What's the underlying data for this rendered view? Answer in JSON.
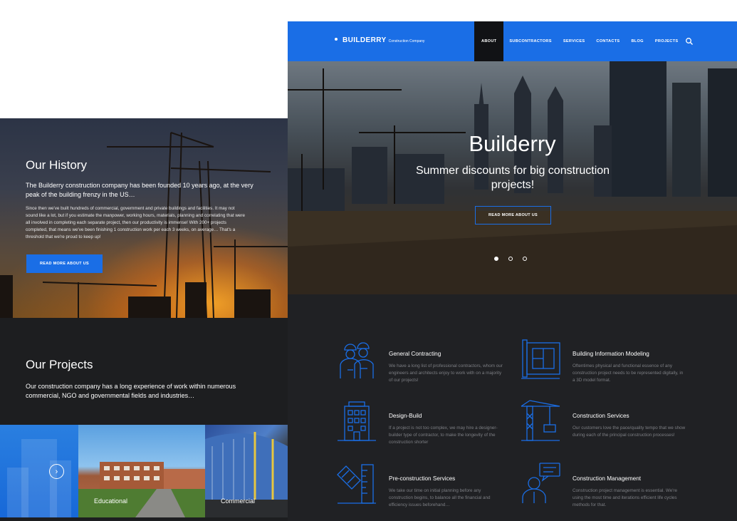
{
  "history": {
    "title": "Our History",
    "lead": "The Builderry construction company has been founded 10 years ago, at the very peak of the building frenzy in the US…",
    "body": "Since then we've built hundreds of commercial, government and private buildings and facilities. It may not sound like a lot, but if you estimate the manpower, working hours, materials, planning and correlating that were all involved in completing each separate project, then our productivity is immense! With 200+ projects completed, that means we've been finishing 1 construction work per each 3 weeks, on average… That's a threshold that we're proud to keep up!",
    "button": "READ MORE ABOUT US"
  },
  "projects": {
    "title": "Our Projects",
    "lead": "Our construction company has a long experience of work within numerous commercial, NGO and governmental fields and industries…",
    "tiles": [
      {
        "label": "Educational"
      },
      {
        "label": "Commercial"
      }
    ],
    "next_icon": "chevron-right-icon"
  },
  "nav": {
    "logo_name": "BUILDERRY",
    "logo_sub": "Construction Company",
    "items": [
      "ABOUT",
      "SUBCONTRACTORS",
      "SERVICES",
      "CONTACTS",
      "BLOG",
      "PROJECTS"
    ],
    "active": "ABOUT",
    "search_icon": "search-icon"
  },
  "hero": {
    "title": "Builderry",
    "subtitle": "Summer discounts for big construction projects!",
    "button": "READ MORE ABOUT US",
    "slides": 3,
    "active_slide": 1
  },
  "services": [
    {
      "icon": "workers-icon",
      "title": "General Contracting",
      "desc": "We have a long list of professional contractors, whom our engineers and architects enjoy to work with on a majority of our projects!"
    },
    {
      "icon": "blueprint-icon",
      "title": "Building Information Modeling",
      "desc": "Oftentimes physical and functional essence of any construction project needs to be represented digitally, in a 3D model format."
    },
    {
      "icon": "building-icon",
      "title": "Design-Build",
      "desc": "If a project is not too complex, we may hire a designer-builder type of contractor, to make the longevity of the construction shorter"
    },
    {
      "icon": "crane-icon",
      "title": "Construction Services",
      "desc": "Our customers love the pace/quality tempo that we show during each of the principal construction processes!"
    },
    {
      "icon": "ruler-icon",
      "title": "Pre-construction Services",
      "desc": "We take our time on initial planning before any construction begins, to balance all the financial and efficiency issues beforehand…"
    },
    {
      "icon": "consultant-icon",
      "title": "Construction Management",
      "desc": "Construction project management is essential. We're using the most time and iterations efficient life cycles methods for that."
    }
  ],
  "colors": {
    "accent": "#1a6ee6",
    "dark": "#202124",
    "nav_active": "#111215"
  }
}
